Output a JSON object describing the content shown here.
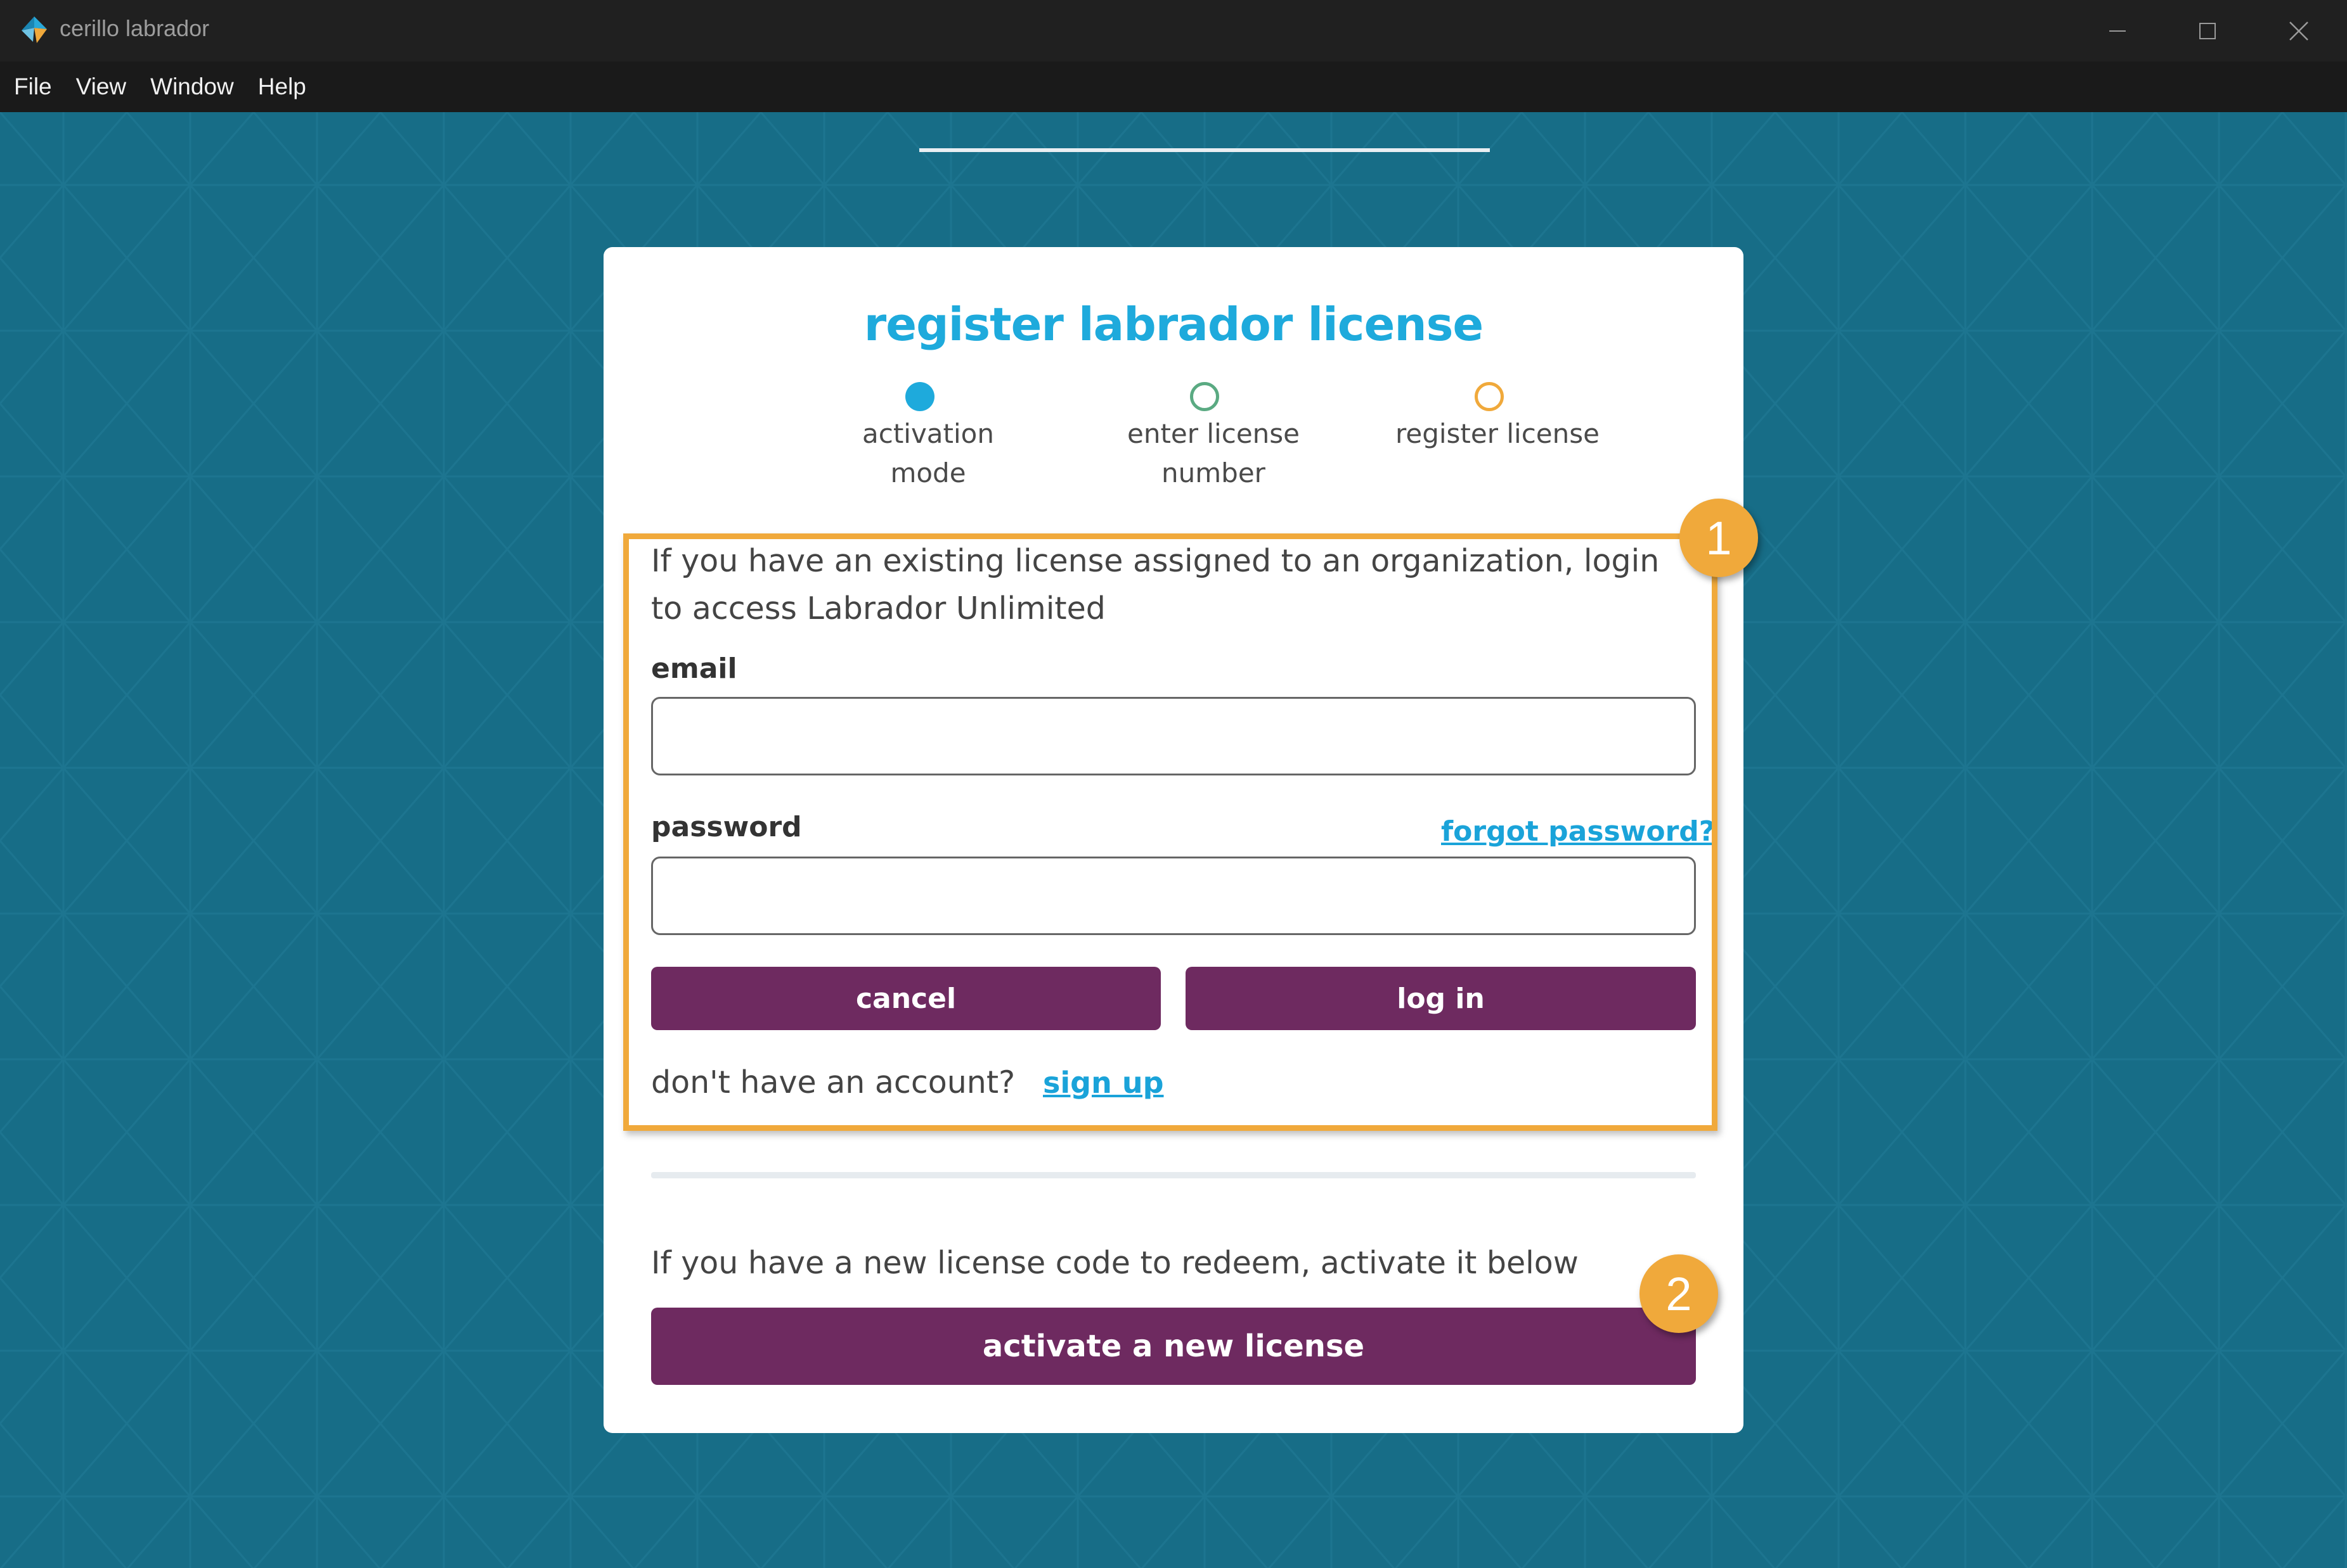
{
  "window": {
    "title": "cerillo labrador",
    "icon": "cerillo-logo-icon",
    "controls": [
      "minimize-icon",
      "maximize-icon",
      "close-icon"
    ]
  },
  "menubar": {
    "items": [
      {
        "label": "File"
      },
      {
        "label": "View"
      },
      {
        "label": "Window"
      },
      {
        "label": "Help"
      }
    ]
  },
  "dialog": {
    "title": "register labrador license",
    "steps": [
      {
        "label": "activation mode",
        "state": "active",
        "color": "#1eaadc"
      },
      {
        "label": "enter license number",
        "state": "pending",
        "color": "#5aaa82"
      },
      {
        "label": "register license",
        "state": "pending",
        "color": "#f0a93b"
      }
    ],
    "login_section": {
      "intro": "If you have an existing license assigned to an organization, login to access Labrador Unlimited",
      "email_label": "email",
      "email_value": "",
      "password_label": "password",
      "password_value": "",
      "forgot_password": "forgot password?",
      "cancel_label": "cancel",
      "login_label": "log in",
      "no_account_text": "don't have an account?",
      "signup_label": "sign up"
    },
    "new_license_section": {
      "intro": "If you have a new license code to redeem, activate it below",
      "activate_label": "activate a new license"
    }
  },
  "annotations": {
    "badge_1": "1",
    "badge_2": "2"
  },
  "colors": {
    "background": "#176d87",
    "title_blue": "#1eaadc",
    "button_purple": "#6e2a60",
    "highlight_orange": "#f0a93b"
  }
}
